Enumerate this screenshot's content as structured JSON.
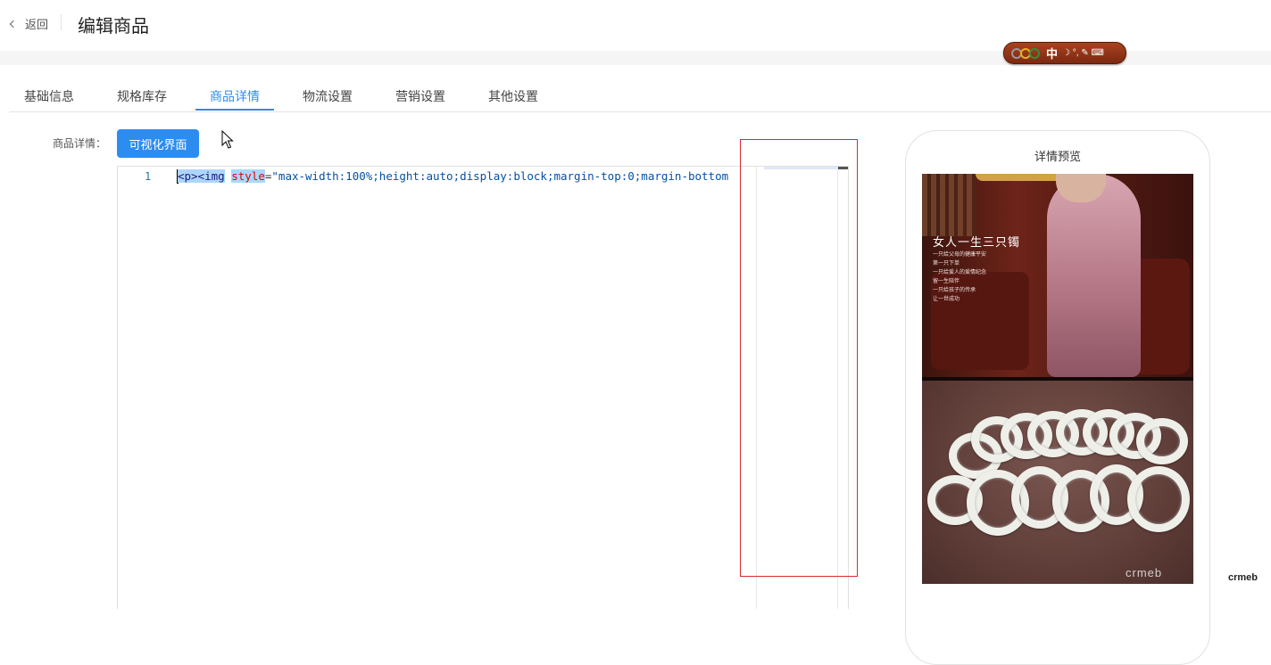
{
  "header": {
    "back_label": "返回",
    "title": "编辑商品"
  },
  "ime_toolbar": {
    "mode": "中",
    "symbols": "☽ °, ✎ ⌨"
  },
  "tabs": [
    {
      "label": "基础信息"
    },
    {
      "label": "规格库存"
    },
    {
      "label": "商品详情"
    },
    {
      "label": "物流设置"
    },
    {
      "label": "营销设置"
    },
    {
      "label": "其他设置"
    }
  ],
  "active_tab": 2,
  "form": {
    "label": "商品详情：",
    "visual_button": "可视化界面"
  },
  "editor": {
    "line_number": "1",
    "code_tag": "<p><img",
    "code_attr": "style",
    "code_eq": "=",
    "code_string": "\"max-width:100%;height:auto;display:block;margin-top:0;margin-bottom"
  },
  "preview": {
    "title": "详情预览",
    "promo_title": "女人一生三只镯",
    "promo_lines": [
      "一只给父母的健康平安",
      "第一只下单",
      "一只给爱人的爱情纪念",
      "留一生陪伴",
      "一只给孩子的传承",
      "让一世成功"
    ],
    "image_watermark": "crmeb"
  },
  "corner_watermark": "crmeb",
  "colors": {
    "accent": "#2d8cf0",
    "highlight": "#d82b2b"
  }
}
